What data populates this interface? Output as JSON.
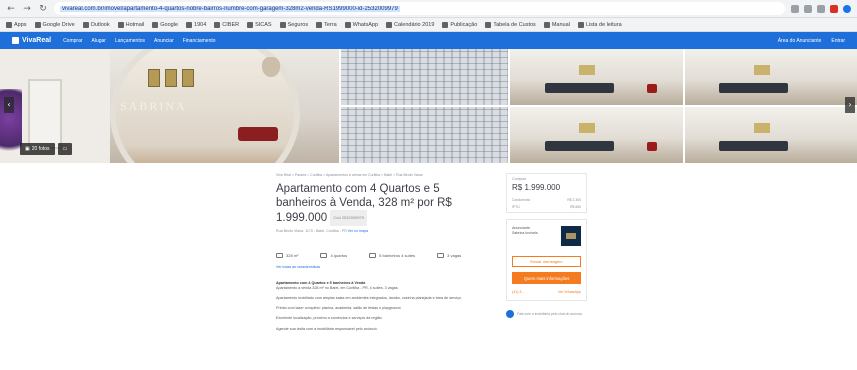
{
  "browser": {
    "url": "vivareal.com.br/imovel/apartamento-4-quartos-nobre-bairros-numbre-com-garagem-328m2-venda-RS1999000-id-2532009979",
    "bookmarks": [
      "Apps",
      "Google Drive",
      "Outlook",
      "Hotmail",
      "Google",
      "1904",
      "CIBER",
      "SICAS",
      "Seguros",
      "Terra",
      "WhatsApp",
      "Calendário 2019",
      "Publicação",
      "Tabela de Custos",
      "Manual",
      "Lista de leitura"
    ]
  },
  "site": {
    "logo": "VivaReal",
    "nav": [
      "Comprar",
      "Alugar",
      "Lançamentos",
      "Anunciar",
      "Financiamento"
    ],
    "nav_right": [
      "Área do Anunciante",
      "Entrar"
    ]
  },
  "gallery": {
    "watermark": "SABRINA",
    "photos_button": "20 fotos"
  },
  "listing": {
    "breadcrumb": "Viva Real > Paraná > Curitiba > Apartamentos à venda em Curitiba > Batel > Rua Bento Viana",
    "title": "Apartamento com 4 Quartos e 5 banheiros à Venda, 328 m² por R$ 1.999.000",
    "code": "Cód 2532009979",
    "address": "Rua Bento Viana, 1170 - Batel, Curitiba - PR",
    "map_link": "Ver no mapa",
    "features": [
      {
        "icon": "area-icon",
        "label": "328 m²"
      },
      {
        "icon": "bed-icon",
        "label": "4 quartos"
      },
      {
        "icon": "bath-icon",
        "label": "5 banheiros 4 suítes"
      },
      {
        "icon": "car-icon",
        "label": "3 vagas"
      }
    ],
    "features_link": "Ver todas as características",
    "description": [
      "Apartamento com 4 Quartos e 5 banheiros à Venda",
      "Apartamento à venda 328 m² no Batel, em Curitiba - PR, 4 suítes, 3 vagas.",
      "Apartamento mobiliado com amplas salas em ambientes integrados, lavabo, cozinha planejada e área de serviço.",
      "Prédio com lazer completo: piscina, academia, salão de festas e playground.",
      "Excelente localização, próximo a comércios e serviços da região.",
      "Agende sua visita com a imobiliária responsável pelo anúncio."
    ]
  },
  "aside": {
    "price_label": "Comprar",
    "price": "R$ 1.999.000",
    "condo_label": "Condomínio",
    "condo_value": "R$ 2.300",
    "iptu_label": "IPTU",
    "iptu_value": "R$ 650",
    "agent_label": "Anunciante",
    "agent_name": "Sabrina Imóveis",
    "btn_contact": "Enviar mensagem",
    "btn_info": "Quero mais informações",
    "phone": "(41) 3...",
    "whatsapp": "Ver WhatsApp",
    "chat_text": "Fale com a imobiliária pelo chat do anúncio"
  }
}
